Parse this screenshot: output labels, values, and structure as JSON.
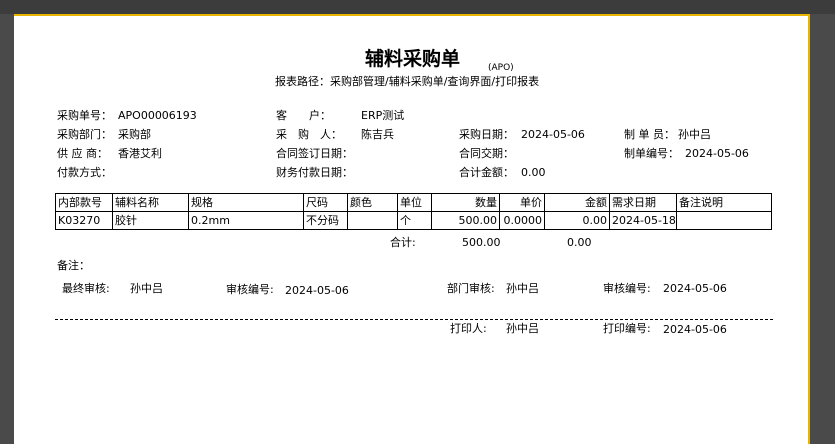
{
  "doc": {
    "title": "辅料采购单",
    "code": "(APO)",
    "path": "报表路径：采购部管理/辅料采购单/查询界面/打印报表"
  },
  "header": {
    "order_no_label": "采购单号：",
    "order_no": "APO00006193",
    "customer_label": "客　　户：",
    "customer": "ERP测试",
    "dept_label": "采购部门：",
    "dept": "采购部",
    "buyer_label": "采　购　人：",
    "buyer": "陈吉兵",
    "purchase_date_label": "采购日期：",
    "purchase_date": "2024-05-06",
    "maker_label": "制 单 员：",
    "maker": "孙中吕",
    "supplier_label": "供 应 商：",
    "supplier": "香港艾利",
    "contract_sign_label": "合同签订日期：",
    "contract_sign": "",
    "contract_delivery_label": "合同交期：",
    "contract_delivery": "",
    "doc_no_label": "制单编号：",
    "doc_no": "2024-05-06",
    "pay_method_label": "付款方式：",
    "pay_method": "",
    "finance_date_label": "财务付款日期：",
    "finance_date": "",
    "total_amount_label": "合计金额：",
    "total_amount": "0.00"
  },
  "table": {
    "columns": [
      "内部款号",
      "辅料名称",
      "规格",
      "尺码",
      "颜色",
      "单位",
      "数量",
      "单价",
      "金额",
      "需求日期",
      "备注说明"
    ],
    "rows": [
      [
        "K03270",
        "胶针",
        "0.2mm",
        "不分码",
        "",
        "个",
        "500.00",
        "0.0000",
        "0.00",
        "2024-05-18",
        ""
      ]
    ],
    "total_label": "合计:",
    "total_qty": "500.00",
    "total_amount": "0.00"
  },
  "footer": {
    "remark_label": "备注：",
    "final_review_label": "最终审核:",
    "final_review": "孙中吕",
    "review_no_label": "审核编号:",
    "review_no": "2024-05-06",
    "dept_review_label": "部门审核:",
    "dept_review": "孙中吕",
    "review_no2_label": "审核编号:",
    "review_no2": "2024-05-06",
    "printer_label": "打印人:",
    "printer": "孙中吕",
    "print_no_label": "打印编号:",
    "print_no": "2024-05-06"
  }
}
